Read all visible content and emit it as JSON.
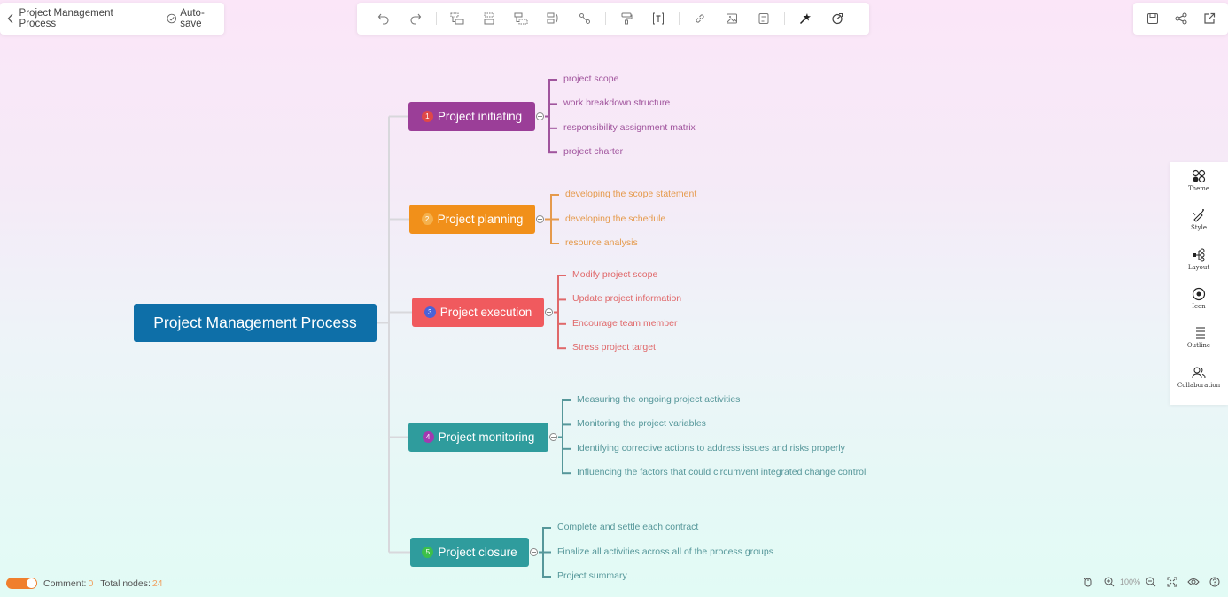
{
  "header": {
    "title": "Project Management Process",
    "autosave_label": "Auto-save"
  },
  "toolbar": {
    "groups": [
      [
        {
          "name": "undo-icon"
        },
        {
          "name": "redo-icon"
        }
      ],
      [
        {
          "name": "insert-subtopic-icon"
        },
        {
          "name": "insert-topic-icon"
        },
        {
          "name": "insert-parent-topic-icon"
        },
        {
          "name": "summary-icon"
        },
        {
          "name": "relationship-icon"
        }
      ],
      [
        {
          "name": "format-painter-icon"
        },
        {
          "name": "text-box-icon"
        }
      ],
      [
        {
          "name": "link-icon"
        },
        {
          "name": "image-icon"
        },
        {
          "name": "note-icon"
        }
      ],
      [
        {
          "name": "magic-ai-icon"
        },
        {
          "name": "timer-icon"
        }
      ]
    ],
    "right": [
      {
        "name": "save-icon"
      },
      {
        "name": "share-icon"
      },
      {
        "name": "export-icon"
      }
    ]
  },
  "side_panel": {
    "items": [
      {
        "icon": "theme-icon",
        "label": "Theme"
      },
      {
        "icon": "style-icon",
        "label": "Style"
      },
      {
        "icon": "layout-icon",
        "label": "Layout"
      },
      {
        "icon": "icon-icon",
        "label": "Icon"
      },
      {
        "icon": "outline-icon",
        "label": "Outline"
      },
      {
        "icon": "collaboration-icon",
        "label": "Collaboration"
      }
    ]
  },
  "mindmap": {
    "root": {
      "label": "Project Management Process",
      "color": "#0e6fa8"
    },
    "connector_color": "#d8d8dc",
    "branches": [
      {
        "number": "1",
        "label": "Project initiating",
        "color": "#9b3e98",
        "badge_color": "#e04848",
        "leaf_color": "#a0549d",
        "children": [
          "project scope",
          "work breakdown structure",
          "responsibility assignment matrix",
          "project charter"
        ]
      },
      {
        "number": "2",
        "label": "Project planning",
        "color": "#f1901a",
        "badge_color": "#f5b14d",
        "leaf_color": "#e59a4c",
        "children": [
          "developing the scope statement",
          "developing the schedule",
          "resource analysis"
        ]
      },
      {
        "number": "3",
        "label": "Project execution",
        "color": "#f05a5e",
        "badge_color": "#4a62d8",
        "leaf_color": "#e0686a",
        "children": [
          "Modify project scope",
          "Update project information",
          "Encourage team member",
          "Stress project target"
        ]
      },
      {
        "number": "4",
        "label": "Project monitoring",
        "color": "#2f9c9d",
        "badge_color": "#a23ab0",
        "leaf_color": "#56979a",
        "children": [
          "Measuring the ongoing project activities",
          "Monitoring the project variables",
          "Identifying corrective actions to address issues and risks properly",
          "Influencing the factors that could circumvent integrated change control"
        ]
      },
      {
        "number": "5",
        "label": "Project closure",
        "color": "#2f9c9d",
        "badge_color": "#3cc04a",
        "leaf_color": "#56979a",
        "children": [
          "Complete and settle each contract",
          "Finalize all activities across all of the process groups",
          "Project summary"
        ]
      }
    ]
  },
  "status": {
    "comment_label": "Comment:",
    "comment_count": "0",
    "nodes_label": "Total nodes:",
    "nodes_count": "24",
    "comment_toggle_on": true,
    "zoom_level": "100%"
  }
}
